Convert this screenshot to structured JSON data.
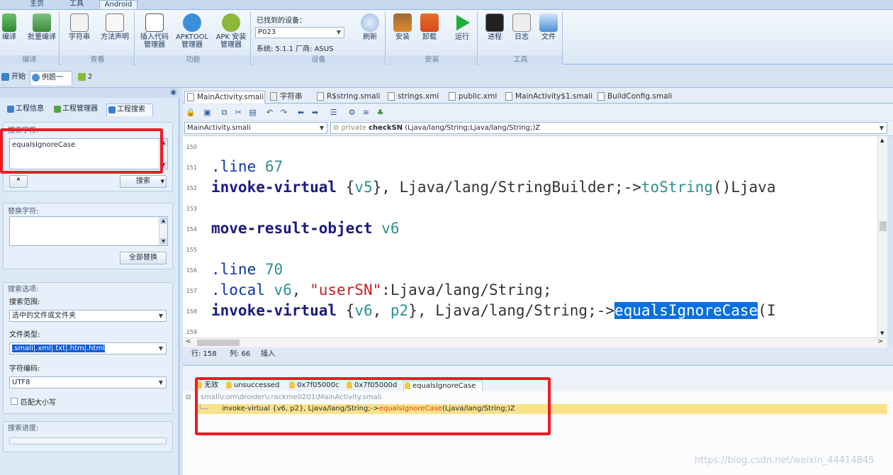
{
  "ribbon_tabs": [
    "主页",
    "工具",
    "Android"
  ],
  "ribbon": {
    "groups": [
      {
        "caption": "编译",
        "buttons": [
          {
            "label": "编译",
            "icon": "compile-icon"
          },
          {
            "label": "批量编译",
            "icon": "batch-compile-icon"
          }
        ]
      },
      {
        "caption": "查看",
        "buttons": [
          {
            "label": "字符串",
            "icon": "strings-icon"
          },
          {
            "label": "方法声明",
            "icon": "method-decl-icon"
          }
        ]
      },
      {
        "caption": "功能",
        "buttons": [
          {
            "label": "插入代码管理器",
            "icon": "insert-code-icon"
          },
          {
            "label": "APKTOOL管理器",
            "icon": "apktool-icon"
          },
          {
            "label": "APK 安装管理器",
            "icon": "apk-install-icon"
          }
        ]
      },
      {
        "caption": "设备",
        "device_title": "已找到的设备：",
        "device": "P023",
        "device_info": "系统: 5.1.1  厂商: ASUS",
        "buttons": [
          {
            "label": "刷新",
            "icon": "refresh-icon"
          }
        ]
      },
      {
        "caption": "安装",
        "buttons": [
          {
            "label": "安装",
            "icon": "install-icon"
          },
          {
            "label": "卸载",
            "icon": "uninstall-icon"
          },
          {
            "label": "运行",
            "icon": "run-icon"
          }
        ]
      },
      {
        "caption": "工具",
        "buttons": [
          {
            "label": "进程",
            "icon": "process-icon"
          },
          {
            "label": "日志",
            "icon": "log-icon"
          },
          {
            "label": "文件",
            "icon": "file-icon"
          }
        ]
      }
    ]
  },
  "doc_tabs": [
    "开始",
    "例题一",
    "2"
  ],
  "left_panel": {
    "tabs": [
      "工程信息",
      "工程管理器",
      "工程搜索"
    ],
    "search_label": "搜索字符:",
    "search_value": "equalsIgnoreCase",
    "search_button": "搜索",
    "replace_label": "替换字符:",
    "replace_value": "",
    "replace_all_button": "全部替换",
    "options_label": "搜索选项:",
    "scope_label": "搜索范围:",
    "scope_value": "选中的文件或文件夹",
    "type_label": "文件类型:",
    "type_value": ".smali|.xml|.txt|.htm|.html",
    "encoding_label": "字符编码:",
    "encoding_value": "UTF8",
    "match_case_label": "匹配大小写",
    "progress_label": "搜索进度:"
  },
  "editor": {
    "tabs": [
      "MainActivity.smali",
      "字符串",
      "R$string.smali",
      "strings.xml",
      "public.xml",
      "MainActivity$1.smali",
      "BuildConfig.smali"
    ],
    "file_combo": "MainActivity.smali",
    "method_combo_prefix": "private",
    "method_combo_name": "checkSN",
    "method_combo_sig": "(Ljava/lang/String;Ljava/lang/String;)Z",
    "lines": [
      {
        "n": "150",
        "tokens": []
      },
      {
        "n": "151",
        "tokens": [
          {
            "t": ".line",
            "c": "dir"
          },
          {
            "t": " 67",
            "c": "reg"
          }
        ]
      },
      {
        "n": "152",
        "tokens": [
          {
            "t": "invoke-virtual",
            "c": "kw"
          },
          {
            "t": " {",
            "c": ""
          },
          {
            "t": "v5",
            "c": "reg"
          },
          {
            "t": "}, Ljava/lang/StringBuilder;->",
            "c": ""
          },
          {
            "t": "toString",
            "c": "meth"
          },
          {
            "t": "()Ljava",
            "c": ""
          }
        ]
      },
      {
        "n": "153",
        "tokens": []
      },
      {
        "n": "154",
        "tokens": [
          {
            "t": "move-result-object",
            "c": "kw"
          },
          {
            "t": " v6",
            "c": "reg"
          }
        ]
      },
      {
        "n": "155",
        "tokens": []
      },
      {
        "n": "156",
        "tokens": [
          {
            "t": ".line",
            "c": "dir"
          },
          {
            "t": " 70",
            "c": "reg"
          }
        ]
      },
      {
        "n": "157",
        "tokens": [
          {
            "t": ".local",
            "c": "dir"
          },
          {
            "t": " v6",
            "c": "reg"
          },
          {
            "t": ", ",
            "c": ""
          },
          {
            "t": "\"userSN\"",
            "c": "str"
          },
          {
            "t": ":Ljava/lang/String;",
            "c": ""
          }
        ]
      },
      {
        "n": "158",
        "tokens": [
          {
            "t": "invoke-virtual",
            "c": "kw"
          },
          {
            "t": " {",
            "c": ""
          },
          {
            "t": "v6",
            "c": "reg"
          },
          {
            "t": ", ",
            "c": ""
          },
          {
            "t": "p2",
            "c": "reg"
          },
          {
            "t": "}, Ljava/lang/String;->",
            "c": ""
          },
          {
            "t": "equalsIgnoreCase",
            "c": "hl"
          },
          {
            "t": "(I",
            "c": ""
          }
        ]
      },
      {
        "n": "159",
        "tokens": []
      }
    ],
    "status_line": "行: 158",
    "status_col": "列: 66",
    "status_mode": "插入"
  },
  "results": {
    "tabs": [
      "无效",
      "unsuccessed",
      "0x7f05000c",
      "0x7f05000d",
      "equalsIgnoreCase"
    ],
    "file_path": "smali\\com\\droider\\crackme0201\\MainActivity.smali",
    "match_prefix": "invoke-virtual {v6, p2}, Ljava/lang/String;->",
    "match_term": "equalsIgnoreCase",
    "match_suffix": "(Ljava/lang/String;)Z"
  },
  "watermark": "https://blog.csdn.net/weixin_44414845",
  "colors": {
    "highlight": "#0a6fe0",
    "red_annotation": "#ec1b23",
    "result_row": "#fbe28a"
  }
}
